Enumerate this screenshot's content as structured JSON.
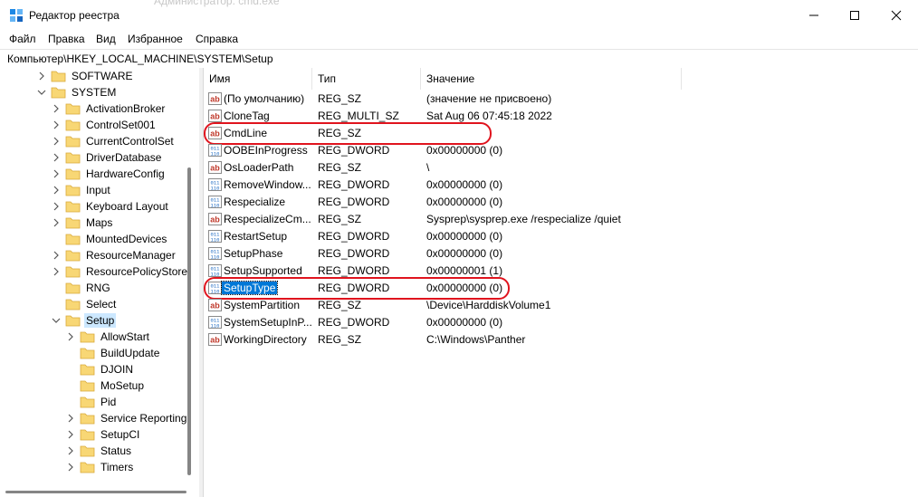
{
  "window": {
    "title": "Редактор реестра",
    "ghost_title": "Администратор: cmd.exe"
  },
  "menu": [
    "Файл",
    "Правка",
    "Вид",
    "Избранное",
    "Справка"
  ],
  "address": "Компьютер\\HKEY_LOCAL_MACHINE\\SYSTEM\\Setup",
  "tree": [
    {
      "label": "SOFTWARE",
      "level": 1,
      "chevron": "right",
      "selected": false
    },
    {
      "label": "SYSTEM",
      "level": 1,
      "chevron": "down",
      "selected": false
    },
    {
      "label": "ActivationBroker",
      "level": 2,
      "chevron": "right",
      "selected": false
    },
    {
      "label": "ControlSet001",
      "level": 2,
      "chevron": "right",
      "selected": false
    },
    {
      "label": "CurrentControlSet",
      "level": 2,
      "chevron": "right",
      "selected": false
    },
    {
      "label": "DriverDatabase",
      "level": 2,
      "chevron": "right",
      "selected": false
    },
    {
      "label": "HardwareConfig",
      "level": 2,
      "chevron": "right",
      "selected": false
    },
    {
      "label": "Input",
      "level": 2,
      "chevron": "right",
      "selected": false
    },
    {
      "label": "Keyboard Layout",
      "level": 2,
      "chevron": "right",
      "selected": false
    },
    {
      "label": "Maps",
      "level": 2,
      "chevron": "right",
      "selected": false
    },
    {
      "label": "MountedDevices",
      "level": 2,
      "chevron": "none",
      "selected": false
    },
    {
      "label": "ResourceManager",
      "level": 2,
      "chevron": "right",
      "selected": false
    },
    {
      "label": "ResourcePolicyStore",
      "level": 2,
      "chevron": "right",
      "selected": false
    },
    {
      "label": "RNG",
      "level": 2,
      "chevron": "none",
      "selected": false
    },
    {
      "label": "Select",
      "level": 2,
      "chevron": "none",
      "selected": false
    },
    {
      "label": "Setup",
      "level": 2,
      "chevron": "down",
      "selected": true
    },
    {
      "label": "AllowStart",
      "level": 3,
      "chevron": "right",
      "selected": false
    },
    {
      "label": "BuildUpdate",
      "level": 3,
      "chevron": "none",
      "selected": false
    },
    {
      "label": "DJOIN",
      "level": 3,
      "chevron": "none",
      "selected": false
    },
    {
      "label": "MoSetup",
      "level": 3,
      "chevron": "none",
      "selected": false
    },
    {
      "label": "Pid",
      "level": 3,
      "chevron": "none",
      "selected": false
    },
    {
      "label": "Service Reporting",
      "level": 3,
      "chevron": "right",
      "selected": false
    },
    {
      "label": "SetupCI",
      "level": 3,
      "chevron": "right",
      "selected": false
    },
    {
      "label": "Status",
      "level": 3,
      "chevron": "right",
      "selected": false
    },
    {
      "label": "Timers",
      "level": 3,
      "chevron": "right",
      "selected": false
    }
  ],
  "columns": {
    "name": "Имя",
    "type": "Тип",
    "data": "Значение"
  },
  "values": [
    {
      "name": "(По умолчанию)",
      "type": "REG_SZ",
      "data": "(значение не присвоено)",
      "icon": "string-value-icon",
      "selected": false,
      "highlighted": false
    },
    {
      "name": "CloneTag",
      "type": "REG_MULTI_SZ",
      "data": "Sat Aug 06 07:45:18 2022",
      "icon": "string-value-icon",
      "selected": false,
      "highlighted": false
    },
    {
      "name": "CmdLine",
      "type": "REG_SZ",
      "data": "",
      "icon": "string-value-icon",
      "selected": false,
      "highlighted": true
    },
    {
      "name": "OOBEInProgress",
      "type": "REG_DWORD",
      "data": "0x00000000 (0)",
      "icon": "binary-value-icon",
      "selected": false,
      "highlighted": false
    },
    {
      "name": "OsLoaderPath",
      "type": "REG_SZ",
      "data": "\\",
      "icon": "string-value-icon",
      "selected": false,
      "highlighted": false
    },
    {
      "name": "RemoveWindow...",
      "type": "REG_DWORD",
      "data": "0x00000000 (0)",
      "icon": "binary-value-icon",
      "selected": false,
      "highlighted": false
    },
    {
      "name": "Respecialize",
      "type": "REG_DWORD",
      "data": "0x00000000 (0)",
      "icon": "binary-value-icon",
      "selected": false,
      "highlighted": false
    },
    {
      "name": "RespecializeCm...",
      "type": "REG_SZ",
      "data": "Sysprep\\sysprep.exe /respecialize /quiet",
      "icon": "string-value-icon",
      "selected": false,
      "highlighted": false
    },
    {
      "name": "RestartSetup",
      "type": "REG_DWORD",
      "data": "0x00000000 (0)",
      "icon": "binary-value-icon",
      "selected": false,
      "highlighted": false
    },
    {
      "name": "SetupPhase",
      "type": "REG_DWORD",
      "data": "0x00000000 (0)",
      "icon": "binary-value-icon",
      "selected": false,
      "highlighted": false
    },
    {
      "name": "SetupSupported",
      "type": "REG_DWORD",
      "data": "0x00000001 (1)",
      "icon": "binary-value-icon",
      "selected": false,
      "highlighted": false
    },
    {
      "name": "SetupType",
      "type": "REG_DWORD",
      "data": "0x00000000 (0)",
      "icon": "binary-value-icon",
      "selected": true,
      "highlighted": true
    },
    {
      "name": "SystemPartition",
      "type": "REG_SZ",
      "data": "\\Device\\HarddiskVolume1",
      "icon": "string-value-icon",
      "selected": false,
      "highlighted": false
    },
    {
      "name": "SystemSetupInP...",
      "type": "REG_DWORD",
      "data": "0x00000000 (0)",
      "icon": "binary-value-icon",
      "selected": false,
      "highlighted": false
    },
    {
      "name": "WorkingDirectory",
      "type": "REG_SZ",
      "data": "C:\\Windows\\Panther",
      "icon": "string-value-icon",
      "selected": false,
      "highlighted": false
    }
  ],
  "colors": {
    "selection_blue": "#0078d7",
    "tree_selection": "#cce8ff",
    "highlight_red": "#e0141e",
    "folder_yellow": "#f8d775"
  }
}
